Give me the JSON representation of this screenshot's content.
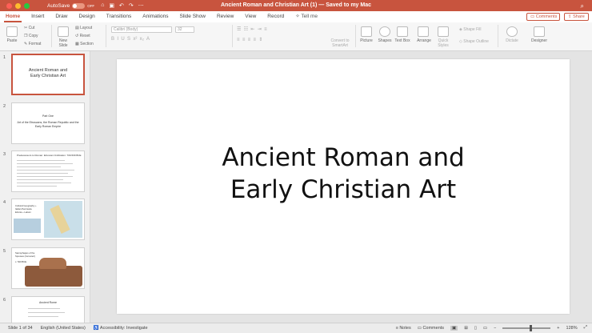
{
  "titlebar": {
    "title": "Ancient Roman and Christian Art (1) — Saved to my Mac",
    "autosave_label": "AutoSave",
    "autosave_state": "OFF",
    "search_icon": "search-icon"
  },
  "tabs": [
    "Home",
    "Insert",
    "Draw",
    "Design",
    "Transitions",
    "Animations",
    "Slide Show",
    "Review",
    "View",
    "Record"
  ],
  "tell_me": "Tell me",
  "header_buttons": {
    "comments": "Comments",
    "share": "Share"
  },
  "ribbon": {
    "paste": "Paste",
    "cut": "Cut",
    "copy": "Copy",
    "format": "Format",
    "new_slide": "New Slide",
    "layout": "Layout",
    "reset": "Reset",
    "section": "Section",
    "font_name": "Calibri (Body)",
    "font_size": "32",
    "convert_smartart": "Convert to SmartArt",
    "picture": "Picture",
    "shapes": "Shapes",
    "text_box": "Text Box",
    "arrange": "Arrange",
    "quick_styles": "Quick Styles",
    "shape_fill": "Shape Fill",
    "shape_outline": "Shape Outline",
    "dictate": "Dictate",
    "designer": "Designer"
  },
  "slides": [
    {
      "num": "1",
      "title": "Ancient Roman and Early Christian Art"
    },
    {
      "num": "2",
      "title": "Part One",
      "subtitle": "Art of the Etruscans, the Roman Republic and the Early Roman Empire"
    },
    {
      "num": "3",
      "title": "Predecessors to Roman: Etruscan Civilization: 700-509 BCE"
    },
    {
      "num": "4",
      "title": "Cultural Geography + Italian Peninsula",
      "subtitle": "Etruria + Latium"
    },
    {
      "num": "5",
      "title": "Sarcophagus of the Spouses (Cerveteri)",
      "subtitle": "c. 520 BCE"
    },
    {
      "num": "6",
      "title": "Ancient Rome"
    }
  ],
  "main_slide": {
    "title": "Ancient Roman and Early Christian Art"
  },
  "statusbar": {
    "slide_of": "Slide 1 of 34",
    "language": "English (United States)",
    "accessibility": "Accessibility: Investigate",
    "notes": "Notes",
    "comments": "Comments",
    "zoom": "128%"
  },
  "colors": {
    "accent": "#c8543e"
  }
}
